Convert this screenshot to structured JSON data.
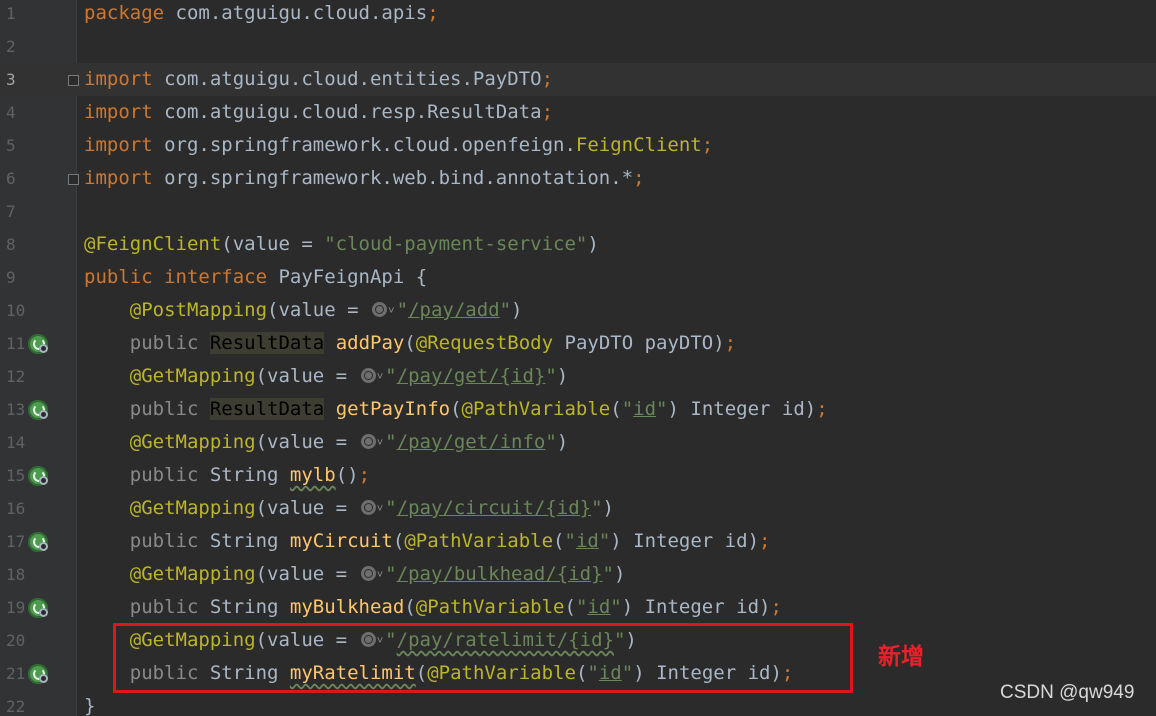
{
  "editor": {
    "lines": [
      {
        "no": "1",
        "segments": [
          [
            "kw",
            "package "
          ],
          [
            "plain",
            "com.atguigu.cloud.apis"
          ],
          [
            "kw",
            ";"
          ]
        ]
      },
      {
        "no": "2",
        "segments": []
      },
      {
        "no": "3",
        "segments": [
          [
            "kw",
            "import "
          ],
          [
            "plain",
            "com.atguigu.cloud.entities.PayDTO"
          ],
          [
            "kw",
            ";"
          ]
        ]
      },
      {
        "no": "4",
        "segments": [
          [
            "kw",
            "import "
          ],
          [
            "plain",
            "com.atguigu.cloud.resp.ResultData"
          ],
          [
            "kw",
            ";"
          ]
        ]
      },
      {
        "no": "5",
        "segments": [
          [
            "kw",
            "import "
          ],
          [
            "plain",
            "org.springframework.cloud.openfeign."
          ],
          [
            "ann",
            "FeignClient"
          ],
          [
            "kw",
            ";"
          ]
        ]
      },
      {
        "no": "6",
        "segments": [
          [
            "kw",
            "import "
          ],
          [
            "plain",
            "org.springframework.web.bind.annotation.*"
          ],
          [
            "kw",
            ";"
          ]
        ]
      },
      {
        "no": "7",
        "segments": []
      },
      {
        "no": "8",
        "segments": [
          [
            "ann",
            "@FeignClient"
          ],
          [
            "plain",
            "(value = "
          ],
          [
            "str",
            "\"cloud-payment-service\""
          ],
          [
            "plain",
            ")"
          ]
        ]
      },
      {
        "no": "9",
        "segments": [
          [
            "kw",
            "public interface "
          ],
          [
            "plain",
            "PayFeignApi {"
          ]
        ]
      },
      {
        "no": "10",
        "segments": [
          [
            "plain",
            "    "
          ],
          [
            "ann",
            "@PostMapping"
          ],
          [
            "plain",
            "(value = "
          ],
          [
            "globe",
            ""
          ],
          [
            "str",
            "\""
          ],
          [
            "link",
            "/pay/add"
          ],
          [
            "str",
            "\""
          ],
          [
            "plain",
            ")"
          ]
        ]
      },
      {
        "no": "11",
        "segments": [
          [
            "plain",
            "    "
          ],
          [
            "dim",
            "public "
          ],
          [
            "hlbox",
            "ResultData"
          ],
          [
            "plain",
            " "
          ],
          [
            "method",
            "addPay"
          ],
          [
            "plain",
            "("
          ],
          [
            "ann",
            "@RequestBody "
          ],
          [
            "plain",
            "PayDTO payDTO)"
          ],
          [
            "kw",
            ";"
          ]
        ]
      },
      {
        "no": "12",
        "segments": [
          [
            "plain",
            "    "
          ],
          [
            "ann",
            "@GetMapping"
          ],
          [
            "plain",
            "(value = "
          ],
          [
            "globe",
            ""
          ],
          [
            "str",
            "\""
          ],
          [
            "link",
            "/pay/get/{id}"
          ],
          [
            "str",
            "\""
          ],
          [
            "plain",
            ")"
          ]
        ]
      },
      {
        "no": "13",
        "segments": [
          [
            "plain",
            "    "
          ],
          [
            "dim",
            "public "
          ],
          [
            "hlbox",
            "ResultData"
          ],
          [
            "plain",
            " "
          ],
          [
            "method",
            "getPayInfo"
          ],
          [
            "plain",
            "("
          ],
          [
            "ann",
            "@PathVariable"
          ],
          [
            "plain",
            "("
          ],
          [
            "str",
            "\""
          ],
          [
            "link",
            "id"
          ],
          [
            "str",
            "\""
          ],
          [
            "plain",
            ") Integer id)"
          ],
          [
            "kw",
            ";"
          ]
        ]
      },
      {
        "no": "14",
        "segments": [
          [
            "plain",
            "    "
          ],
          [
            "ann",
            "@GetMapping"
          ],
          [
            "plain",
            "(value = "
          ],
          [
            "globe",
            ""
          ],
          [
            "str",
            "\""
          ],
          [
            "link",
            "/pay/get/info"
          ],
          [
            "str",
            "\""
          ],
          [
            "plain",
            ")"
          ]
        ]
      },
      {
        "no": "15",
        "segments": [
          [
            "plain",
            "    "
          ],
          [
            "dim",
            "public "
          ],
          [
            "plain",
            "String "
          ],
          [
            "methodtypo",
            "mylb"
          ],
          [
            "plain",
            "()"
          ],
          [
            "kw",
            ";"
          ]
        ]
      },
      {
        "no": "16",
        "segments": [
          [
            "plain",
            "    "
          ],
          [
            "ann",
            "@GetMapping"
          ],
          [
            "plain",
            "(value = "
          ],
          [
            "globe",
            ""
          ],
          [
            "str",
            "\""
          ],
          [
            "link",
            "/pay/circuit/{id}"
          ],
          [
            "str",
            "\""
          ],
          [
            "plain",
            ")"
          ]
        ]
      },
      {
        "no": "17",
        "segments": [
          [
            "plain",
            "    "
          ],
          [
            "dim",
            "public "
          ],
          [
            "plain",
            "String "
          ],
          [
            "method",
            "myCircuit"
          ],
          [
            "plain",
            "("
          ],
          [
            "ann",
            "@PathVariable"
          ],
          [
            "plain",
            "("
          ],
          [
            "str",
            "\""
          ],
          [
            "link",
            "id"
          ],
          [
            "str",
            "\""
          ],
          [
            "plain",
            ") Integer id)"
          ],
          [
            "kw",
            ";"
          ]
        ]
      },
      {
        "no": "18",
        "segments": [
          [
            "plain",
            "    "
          ],
          [
            "ann",
            "@GetMapping"
          ],
          [
            "plain",
            "(value = "
          ],
          [
            "globe",
            ""
          ],
          [
            "str",
            "\""
          ],
          [
            "link",
            "/pay/bulkhead/{id}"
          ],
          [
            "str",
            "\""
          ],
          [
            "plain",
            ")"
          ]
        ]
      },
      {
        "no": "19",
        "segments": [
          [
            "plain",
            "    "
          ],
          [
            "dim",
            "public "
          ],
          [
            "plain",
            "String "
          ],
          [
            "method",
            "myBulkhead"
          ],
          [
            "plain",
            "("
          ],
          [
            "ann",
            "@PathVariable"
          ],
          [
            "plain",
            "("
          ],
          [
            "str",
            "\""
          ],
          [
            "link",
            "id"
          ],
          [
            "str",
            "\""
          ],
          [
            "plain",
            ") Integer id)"
          ],
          [
            "kw",
            ";"
          ]
        ]
      },
      {
        "no": "20",
        "segments": [
          [
            "plain",
            "    "
          ],
          [
            "ann",
            "@GetMapping"
          ],
          [
            "plain",
            "(value = "
          ],
          [
            "globe",
            ""
          ],
          [
            "str",
            "\""
          ],
          [
            "linktypo",
            "/pay/ratelimit/{id}"
          ],
          [
            "str",
            "\""
          ],
          [
            "plain",
            ")"
          ]
        ]
      },
      {
        "no": "21",
        "segments": [
          [
            "plain",
            "    "
          ],
          [
            "dim",
            "public "
          ],
          [
            "plain",
            "String "
          ],
          [
            "methodtypo",
            "myRatelimit"
          ],
          [
            "plain",
            "("
          ],
          [
            "ann",
            "@PathVariable"
          ],
          [
            "plain",
            "("
          ],
          [
            "str",
            "\""
          ],
          [
            "link",
            "id"
          ],
          [
            "str",
            "\""
          ],
          [
            "plain",
            ") Integer id)"
          ],
          [
            "kw",
            ";"
          ]
        ]
      },
      {
        "no": "22",
        "segments": [
          [
            "plain",
            "}"
          ]
        ]
      }
    ],
    "current_line": "3",
    "impl_icon_lines": [
      "11",
      "13",
      "15",
      "17",
      "19",
      "21"
    ],
    "fold_lines": [
      "3",
      "6"
    ]
  },
  "annotation": {
    "label": "新增"
  },
  "watermark": "CSDN @qw949"
}
